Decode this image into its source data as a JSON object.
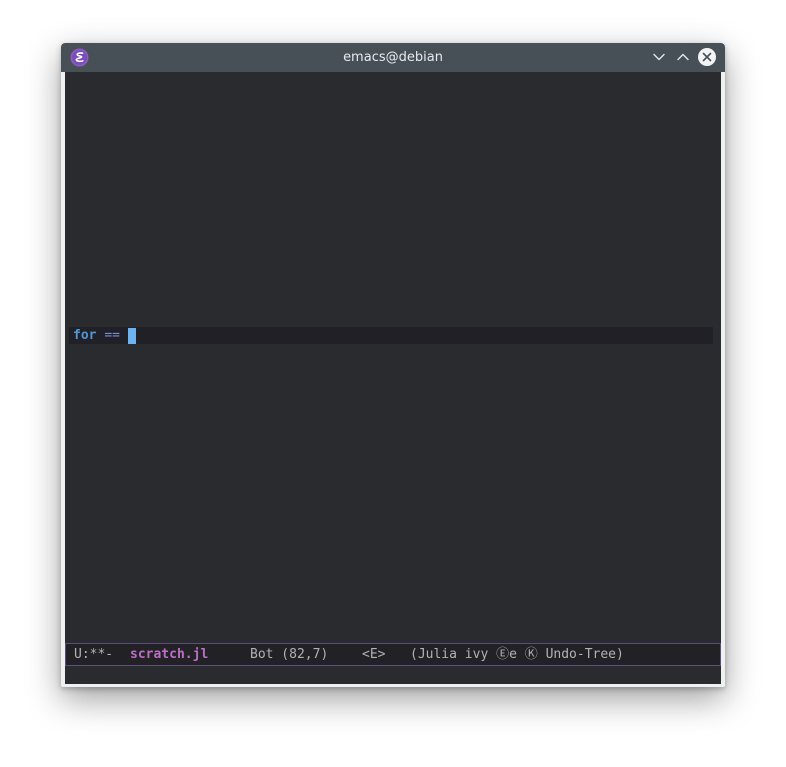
{
  "window": {
    "title": "emacs@debian",
    "icons": {
      "app": "emacs-icon",
      "minimize": "chevron-down-icon",
      "maximize": "chevron-up-icon",
      "close": "close-icon"
    }
  },
  "editor": {
    "code": {
      "keyword": "for",
      "operator": "=="
    }
  },
  "modeline": {
    "state": "U:**-",
    "buffer_name": "scratch.jl",
    "position": "Bot (82,7)",
    "evil_state": "<E>",
    "modes": "(Julia ivy Ⓔe Ⓚ Undo-Tree)"
  },
  "colors": {
    "titlebar": "#475057",
    "editor_bg": "#292b2e",
    "keyword": "#4f97d7",
    "buffer_name": "#bc6ec5",
    "cursor": "#6cb3f0"
  }
}
